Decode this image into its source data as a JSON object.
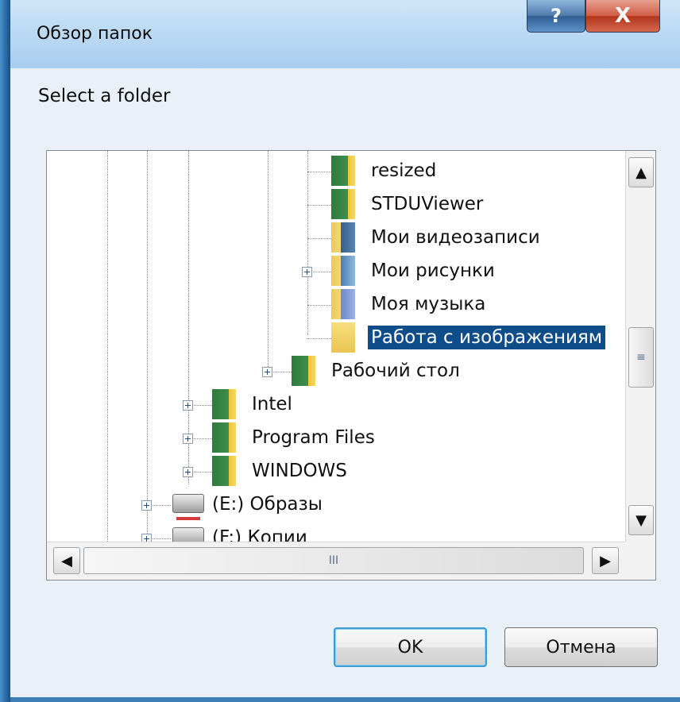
{
  "window": {
    "title": "Обзор папок",
    "help_label": "?",
    "close_label": "X"
  },
  "prompt": "Select a folder",
  "tree": {
    "items": [
      {
        "label": "resized",
        "icon": "green-folder-icon"
      },
      {
        "label": "STDUViewer",
        "icon": "green-folder-icon"
      },
      {
        "label": "Мои видеозаписи",
        "icon": "video-folder-icon"
      },
      {
        "label": "Мои рисунки",
        "icon": "pictures-folder-icon",
        "expandable": true
      },
      {
        "label": "Моя музыка",
        "icon": "music-folder-icon"
      },
      {
        "label": "Работа с изображениям",
        "icon": "folder-icon",
        "selected": true
      },
      {
        "label": "Рабочий стол",
        "icon": "green-folder-icon",
        "expandable": true
      },
      {
        "label": "Intel",
        "icon": "green-folder-icon",
        "expandable": true
      },
      {
        "label": "Program Files",
        "icon": "green-folder-icon",
        "expandable": true
      },
      {
        "label": "WINDOWS",
        "icon": "green-folder-icon",
        "expandable": true
      },
      {
        "label": "(E:) Образы",
        "icon": "drive-icon",
        "expandable": true
      },
      {
        "label": "(F:) Копии",
        "icon": "drive-icon",
        "expandable": true
      }
    ]
  },
  "scrollbar": {
    "up": "▲",
    "down": "▼",
    "left": "◀",
    "right": "▶",
    "v_grip": "≡",
    "h_grip": "III"
  },
  "buttons": {
    "ok": "OK",
    "cancel": "Отмена"
  },
  "colors": {
    "selection": "#0f4c8a",
    "ok_focus_border": "#3d9bd0"
  }
}
